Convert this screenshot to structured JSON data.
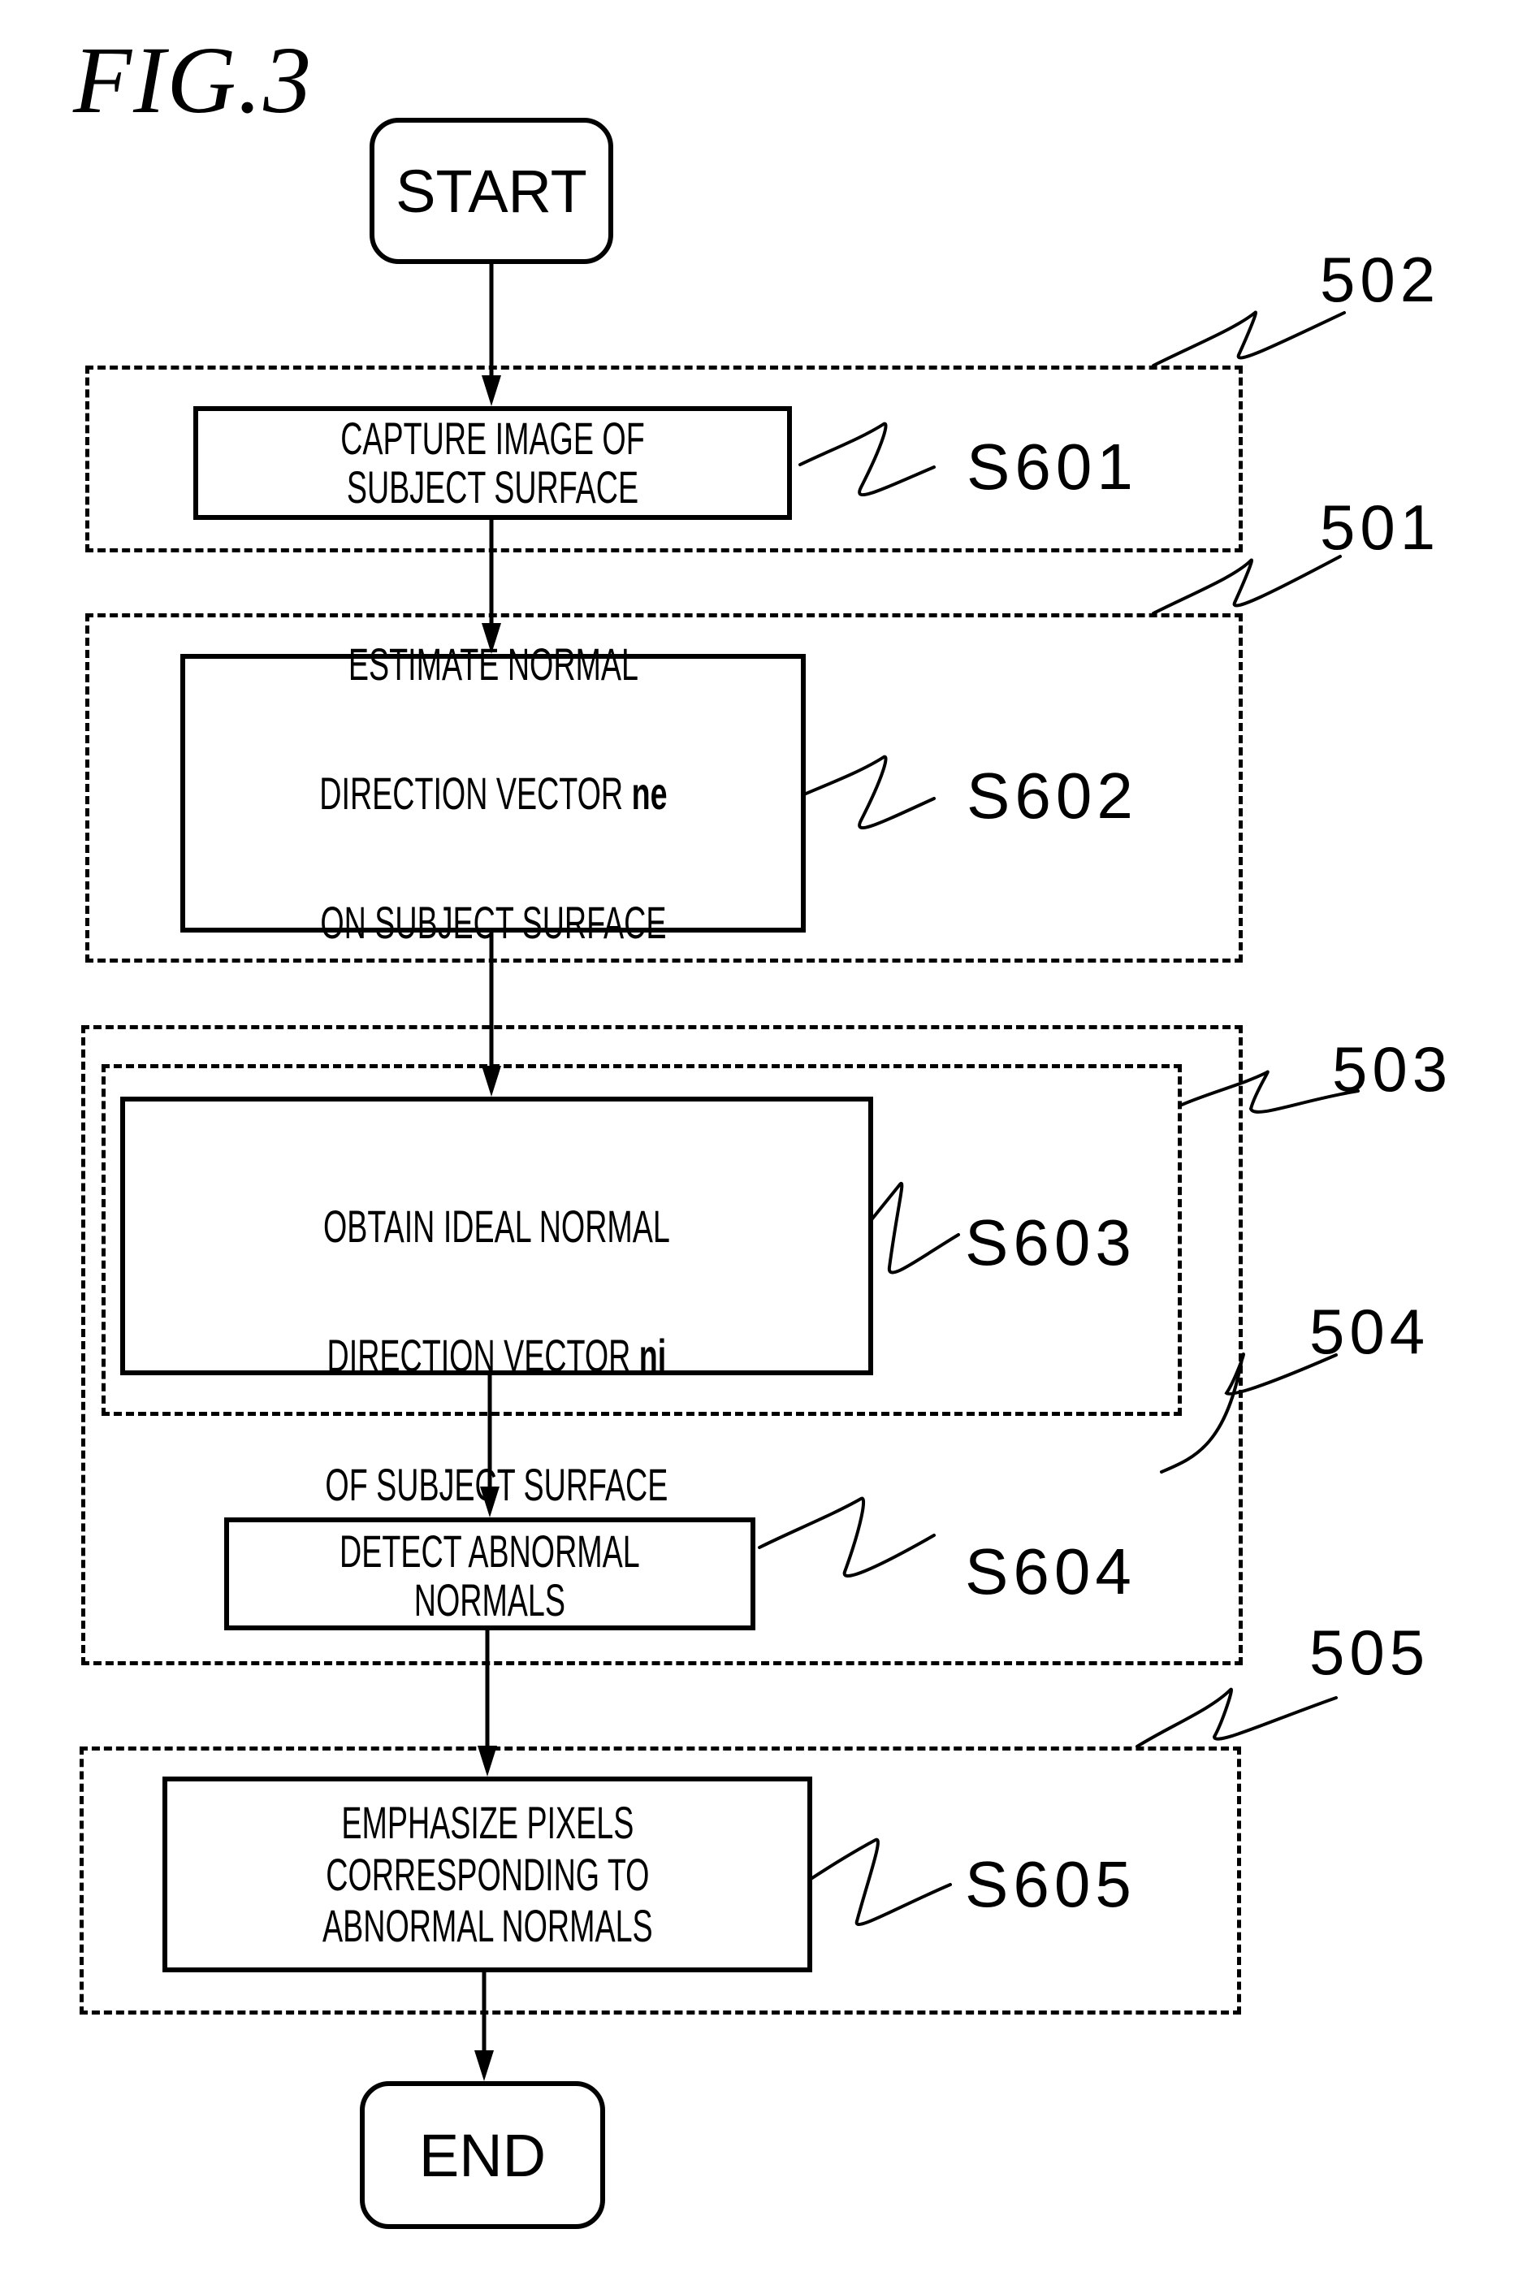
{
  "figure": {
    "title": "FIG.3"
  },
  "terminals": {
    "start": "START",
    "end": "END"
  },
  "steps": [
    {
      "id": "S601",
      "lines": [
        "CAPTURE IMAGE OF",
        "SUBJECT SURFACE"
      ]
    },
    {
      "id": "S602",
      "lines": [
        "ESTIMATE NORMAL",
        "DIRECTION VECTOR ",
        "ON SUBJECT SURFACE"
      ],
      "bold_var": "ne"
    },
    {
      "id": "S603",
      "lines": [
        "OBTAIN IDEAL NORMAL",
        "DIRECTION VECTOR ",
        "OF SUBJECT SURFACE"
      ],
      "bold_var": "ni"
    },
    {
      "id": "S604",
      "lines": [
        "DETECT ABNORMAL",
        "NORMALS"
      ]
    },
    {
      "id": "S605",
      "lines": [
        "EMPHASIZE PIXELS",
        "CORRESPONDING TO",
        "ABNORMAL NORMALS"
      ]
    }
  ],
  "groups": [
    {
      "ref": "502",
      "contains": [
        "S601"
      ]
    },
    {
      "ref": "501",
      "contains": [
        "S602"
      ]
    },
    {
      "ref": "503",
      "contains": [
        "S603"
      ]
    },
    {
      "ref": "504",
      "contains": [
        "S603",
        "S604"
      ]
    },
    {
      "ref": "505",
      "contains": [
        "S605"
      ]
    }
  ]
}
